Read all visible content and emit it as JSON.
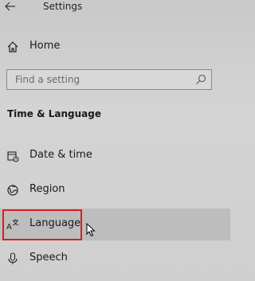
{
  "window": {
    "title": "Settings"
  },
  "nav": {
    "home": {
      "label": "Home",
      "icon": "home-icon"
    },
    "search": {
      "placeholder": "Find a setting",
      "icon": "search-icon"
    }
  },
  "section": {
    "title": "Time & Language"
  },
  "items": [
    {
      "label": "Date & time",
      "icon": "date-time-icon"
    },
    {
      "label": "Region",
      "icon": "globe-icon"
    },
    {
      "label": "Language",
      "icon": "language-icon",
      "selected": true
    },
    {
      "label": "Speech",
      "icon": "microphone-icon"
    }
  ],
  "colors": {
    "highlight": "#e01c1c",
    "hover_row": "#bdbdbd"
  }
}
